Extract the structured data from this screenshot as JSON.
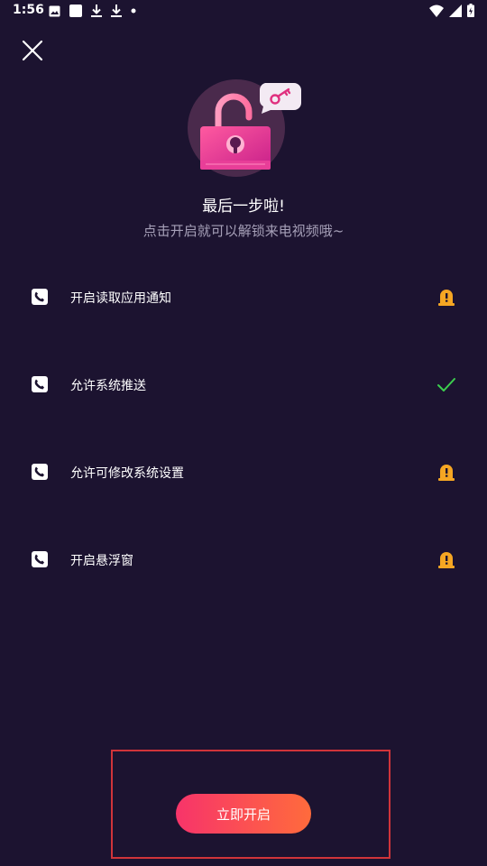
{
  "status_bar": {
    "time": "1:56",
    "notification_icons": [
      "image-icon",
      "square-icon",
      "download-icon",
      "download-icon",
      "dot-icon"
    ],
    "system_icons": [
      "wifi-icon",
      "signal-icon",
      "battery-icon"
    ]
  },
  "header": {
    "close_icon": "close-icon"
  },
  "hero": {
    "title": "最后一步啦!",
    "subtitle": "点击开启就可以解锁来电视频哦~"
  },
  "permissions": [
    {
      "label": "开启读取应用通知",
      "status": "warning",
      "status_icon": "alert-icon"
    },
    {
      "label": "允许系统推送",
      "status": "granted",
      "status_icon": "check-icon"
    },
    {
      "label": "允许可修改系统设置",
      "status": "warning",
      "status_icon": "alert-icon"
    },
    {
      "label": "开启悬浮窗",
      "status": "warning",
      "status_icon": "alert-icon"
    }
  ],
  "action": {
    "button_label": "立即开启"
  },
  "colors": {
    "background": "#1c1330",
    "warning": "#f5a623",
    "granted": "#3ccf4e",
    "button_start": "#f7346a",
    "button_end": "#ff6b3c",
    "highlight": "#d0343a"
  }
}
